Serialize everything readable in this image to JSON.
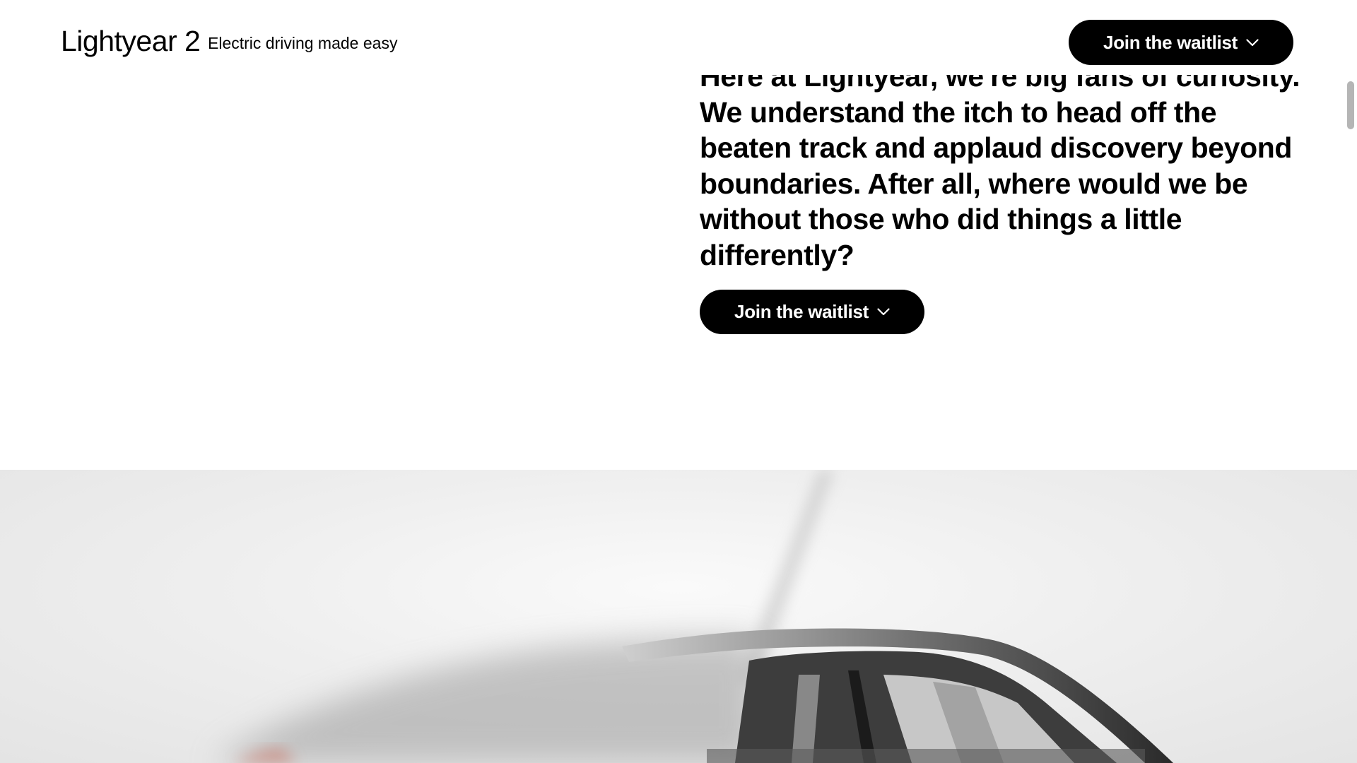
{
  "header": {
    "brand": "Lightyear 2",
    "tagline": "Electric driving made easy",
    "cta_label": "Join the waitlist"
  },
  "hero": {
    "partial_line": "Here at Lightyear, we're big fans of curiosity.",
    "lines": [
      "We understand the itch to head off the",
      "beaten track and applaud discovery beyond",
      "boundaries. After all, where would we be",
      "without those who did things a little",
      "differently?"
    ],
    "cta_label": "Join the waitlist"
  },
  "icons": {
    "header_cta": "chevron-down-icon",
    "hero_cta": "chevron-down-icon"
  },
  "colors": {
    "background": "#ffffff",
    "button_bg": "#000000",
    "button_text": "#ffffff",
    "photo_bg": "#ececec"
  }
}
